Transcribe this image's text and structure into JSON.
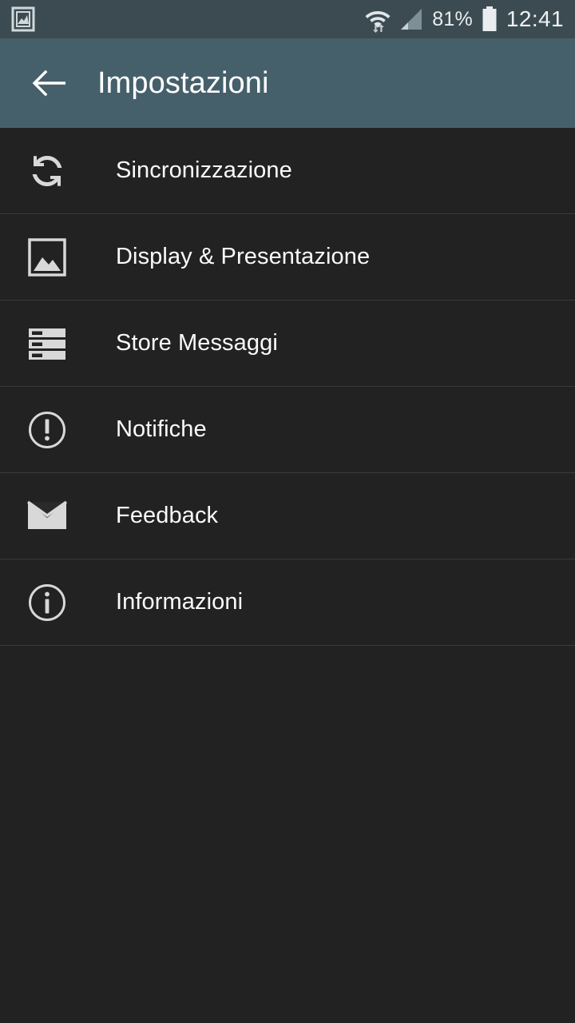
{
  "status_bar": {
    "notification_icon": "image-notification-icon",
    "wifi_icon": "wifi-transfer-icon",
    "signal_icon": "cellular-signal-icon",
    "battery_percent": "81%",
    "battery_icon": "battery-icon",
    "clock": "12:41",
    "background_color": "#3c4b52",
    "text_color": "#e9edef"
  },
  "app_bar": {
    "back_icon": "arrow-left-icon",
    "title": "Impostazioni",
    "background_color": "#46606b",
    "title_color": "#ffffff"
  },
  "settings_list": {
    "background_color": "#222222",
    "divider_color": "#3a3a3a",
    "label_color": "#fafafa",
    "icon_color": "#d8d8d8",
    "items": [
      {
        "label": "Sincronizzazione",
        "icon": "sync-icon"
      },
      {
        "label": "Display & Presentazione",
        "icon": "image-icon"
      },
      {
        "label": "Store Messaggi",
        "icon": "storage-icon"
      },
      {
        "label": "Notifiche",
        "icon": "alert-circle-icon"
      },
      {
        "label": "Feedback",
        "icon": "mail-icon"
      },
      {
        "label": "Informazioni",
        "icon": "info-circle-icon"
      }
    ]
  }
}
